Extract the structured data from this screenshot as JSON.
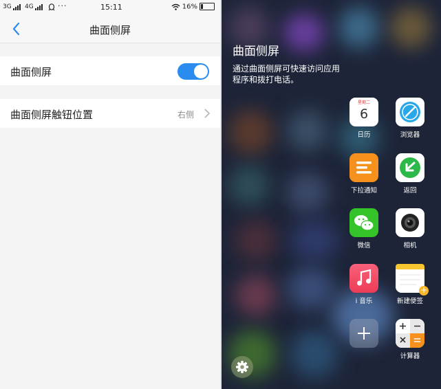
{
  "status_bar": {
    "net1": "3G",
    "net2": "4G",
    "time": "15:11",
    "battery": "16%"
  },
  "settings": {
    "title": "曲面侧屏",
    "rows": [
      {
        "label": "曲面侧屏",
        "toggle_on": true
      },
      {
        "label": "曲面侧屏触钮位置",
        "value": "右侧"
      }
    ]
  },
  "edge_panel": {
    "title": "曲面侧屏",
    "description": "通过曲面侧屏可快速访问应用程序和拨打电话。",
    "calendar": {
      "weekday": "星期二",
      "day": "6"
    },
    "apps": [
      {
        "name": "日历",
        "icon": "calendar-icon"
      },
      {
        "name": "浏览器",
        "icon": "browser-icon"
      },
      {
        "name": "下拉通知",
        "icon": "notification-pulldown-icon"
      },
      {
        "name": "返回",
        "icon": "back-arrow-icon"
      },
      {
        "name": "微信",
        "icon": "wechat-icon"
      },
      {
        "name": "相机",
        "icon": "camera-icon"
      },
      {
        "name": "i 音乐",
        "icon": "music-icon"
      },
      {
        "name": "新建便签",
        "icon": "note-icon"
      },
      {
        "name": "",
        "icon": "add-icon"
      },
      {
        "name": "计算器",
        "icon": "calculator-icon"
      }
    ],
    "colors": {
      "toggle_on": "#2b8cf0",
      "browser": "#2aa7e8",
      "notify": "#f6911e",
      "back": "#2db84a",
      "wechat": "#35c32a",
      "music": "#f25066",
      "note": "#f7c62e"
    }
  }
}
